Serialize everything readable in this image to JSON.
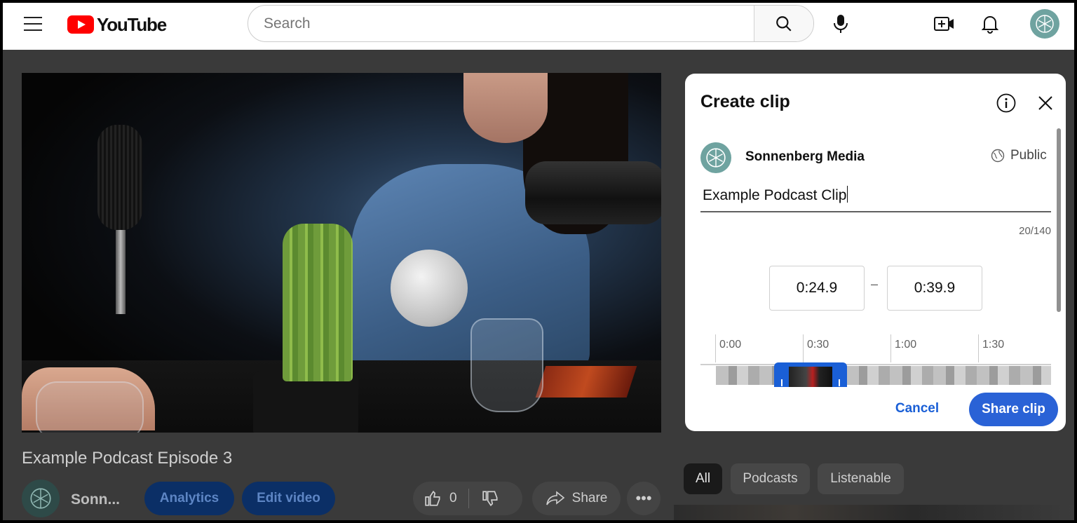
{
  "header": {
    "logo_text": "YouTube",
    "search": {
      "placeholder": "Search",
      "value": ""
    }
  },
  "video": {
    "title": "Example Podcast Episode 3",
    "channel_name": "Sonn...",
    "buttons": {
      "analytics": "Analytics",
      "edit": "Edit video"
    },
    "like_count": "0",
    "share_label": "Share"
  },
  "chips": [
    "All",
    "Podcasts",
    "Listenable"
  ],
  "clip_panel": {
    "title": "Create clip",
    "owner": "Sonnenberg Media",
    "visibility": "Public",
    "clip_title": "Example Podcast Clip",
    "char_count": "20/140",
    "start_time": "0:24.9",
    "separator": "–",
    "end_time": "0:39.9",
    "timeline_ticks": [
      "0:00",
      "0:30",
      "1:00",
      "1:30"
    ],
    "cancel": "Cancel",
    "share": "Share clip"
  },
  "colors": {
    "brand_red": "#ff0000",
    "accent_blue": "#2a62d6",
    "link_blue": "#1a5fd6",
    "backdrop": "#3a3a3a"
  }
}
